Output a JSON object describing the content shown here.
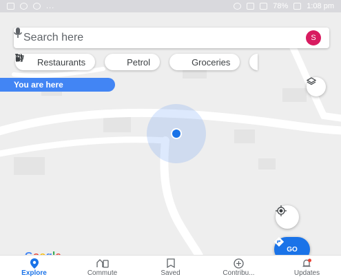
{
  "status_bar": {
    "left_icons": [
      "image-icon",
      "chat-icon",
      "person-icon"
    ],
    "dots": "...",
    "battery_percent": "78%",
    "time": "1:08 pm"
  },
  "search": {
    "placeholder": "Search here",
    "avatar_initial": "S"
  },
  "chips": [
    {
      "label": "Restaurants",
      "icon": "restaurant-icon"
    },
    {
      "label": "Petrol",
      "icon": "fuel-icon"
    },
    {
      "label": "Groceries",
      "icon": "cart-icon"
    }
  ],
  "map": {
    "you_are_here": "You are here",
    "go_label": "GO",
    "logo": [
      "G",
      "o",
      "o",
      "g",
      "l",
      "e"
    ]
  },
  "nav": [
    {
      "label": "Explore",
      "icon": "explore-pin-icon",
      "active": true
    },
    {
      "label": "Commute",
      "icon": "commute-icon",
      "active": false
    },
    {
      "label": "Saved",
      "icon": "bookmark-icon",
      "active": false
    },
    {
      "label": "Contribu...",
      "icon": "add-circle-icon",
      "active": false
    },
    {
      "label": "Updates",
      "icon": "bell-icon",
      "active": false
    }
  ],
  "colors": {
    "accent": "#1a73e8",
    "avatar": "#d81b60",
    "map_bg": "#eeeeee",
    "road": "#ffffff"
  }
}
